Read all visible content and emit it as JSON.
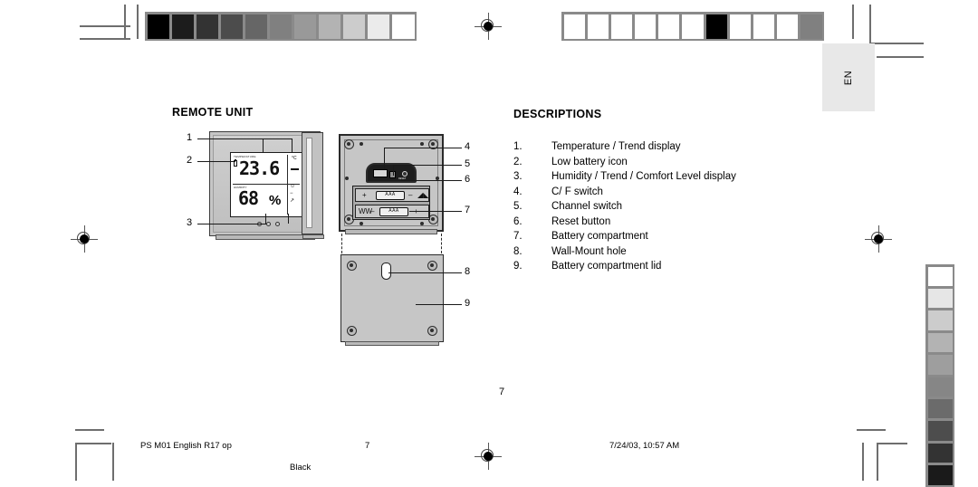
{
  "document": {
    "language_tab": "EN",
    "page_number": "7",
    "footer": {
      "file_label": "PS M01 English R17 op",
      "page": "7",
      "timestamp": "7/24/03, 10:57 AM",
      "plate": "Black"
    }
  },
  "sections": {
    "remote_unit": {
      "title": "REMOTE UNIT"
    },
    "descriptions": {
      "title": "DESCRIPTIONS",
      "items": [
        {
          "num": "1.",
          "text": "Temperature / Trend display"
        },
        {
          "num": "2.",
          "text": "Low battery icon"
        },
        {
          "num": "3.",
          "text": "Humidity / Trend / Comfort Level display"
        },
        {
          "num": "4.",
          "text": " C/ F switch"
        },
        {
          "num": "5.",
          "text": "Channel switch"
        },
        {
          "num": "6.",
          "text": "Reset button"
        },
        {
          "num": "7.",
          "text": "Battery compartment"
        },
        {
          "num": "8.",
          "text": "Wall-Mount hole"
        },
        {
          "num": "9.",
          "text": "Battery compartment lid"
        }
      ]
    }
  },
  "diagram": {
    "front_view": {
      "callouts": [
        {
          "id": "1",
          "label": "1"
        },
        {
          "id": "2",
          "label": "2"
        },
        {
          "id": "3",
          "label": "3"
        }
      ],
      "lcd": {
        "temperature_value": "23.6",
        "temperature_unit": "°C",
        "humidity_value": "68",
        "humidity_unit": "%",
        "temp_section_label": "TEMPERATURE",
        "humidity_section_label": "HUMIDITY",
        "battery_icon": "low-battery",
        "comfort_icons": ":-)  —  :-("
      }
    },
    "back_view": {
      "callouts": [
        {
          "id": "4",
          "label": "4"
        },
        {
          "id": "5",
          "label": "5"
        },
        {
          "id": "6",
          "label": "6"
        },
        {
          "id": "7",
          "label": "7"
        }
      ],
      "reset_label": "RESET",
      "battery_type": "AAA",
      "battery_polarity_top_left": "+",
      "battery_polarity_top_right": "–",
      "battery_polarity_bottom_left": "–",
      "battery_polarity_bottom_right": "+"
    },
    "lid_view": {
      "callouts": [
        {
          "id": "8",
          "label": "8"
        },
        {
          "id": "9",
          "label": "9"
        }
      ]
    }
  },
  "print_marks": {
    "grayscale_top_left": [
      "#000000",
      "#1c1c1c",
      "#333333",
      "#4c4c4c",
      "#666666",
      "#808080",
      "#999999",
      "#b3b3b3",
      "#cccccc",
      "#ebebeb",
      "#ffffff"
    ],
    "grayscale_top_right": [
      "#ffffff",
      "#ffffff",
      "#ffffff",
      "#ffffff",
      "#ffffff",
      "#ffffff",
      "#000000",
      "#ffffff",
      "#ffffff",
      "#ffffff",
      "#808080"
    ],
    "grayscale_right_vertical": [
      "#ffffff",
      "#e6e6e6",
      "#cccccc",
      "#b3b3b3",
      "#9e9e9e",
      "#868686",
      "#6b6b6b",
      "#4d4d4d",
      "#333333",
      "#1a1a1a"
    ],
    "registration_marks": 4
  }
}
